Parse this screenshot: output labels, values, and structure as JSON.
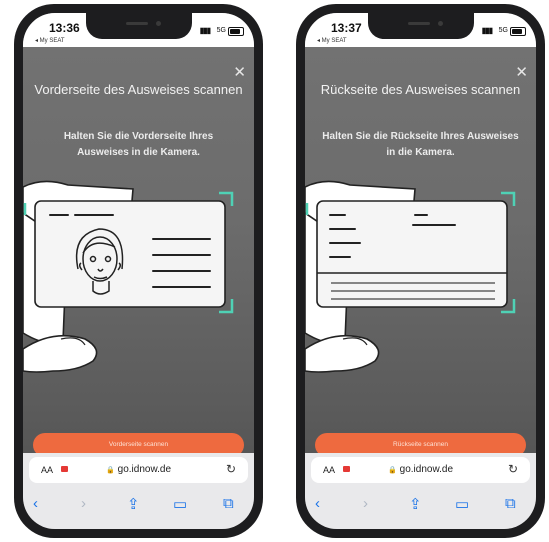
{
  "screens": [
    {
      "status": {
        "time": "13:36",
        "back_app": "◂ My SEAT",
        "network": "5G"
      },
      "title": "Vorderseite des Ausweises scannen",
      "subtitle": "Halten Sie die Vorderseite Ihres Ausweises in die Kamera.",
      "button": "Vorderseite scannen",
      "browser": {
        "aa": "AA",
        "url": "go.idnow.de"
      }
    },
    {
      "status": {
        "time": "13:37",
        "back_app": "◂ My SEAT",
        "network": "5G"
      },
      "title": "Rückseite des Ausweises scannen",
      "subtitle": "Halten Sie die Rückseite Ihres Ausweises in die Kamera.",
      "button": "Rückseite scannen",
      "browser": {
        "aa": "AA",
        "url": "go.idnow.de"
      }
    }
  ],
  "colors": {
    "accent": "#ee6a3f",
    "frame_corners": "#4fd1b5",
    "link_blue": "#1a73e8"
  }
}
